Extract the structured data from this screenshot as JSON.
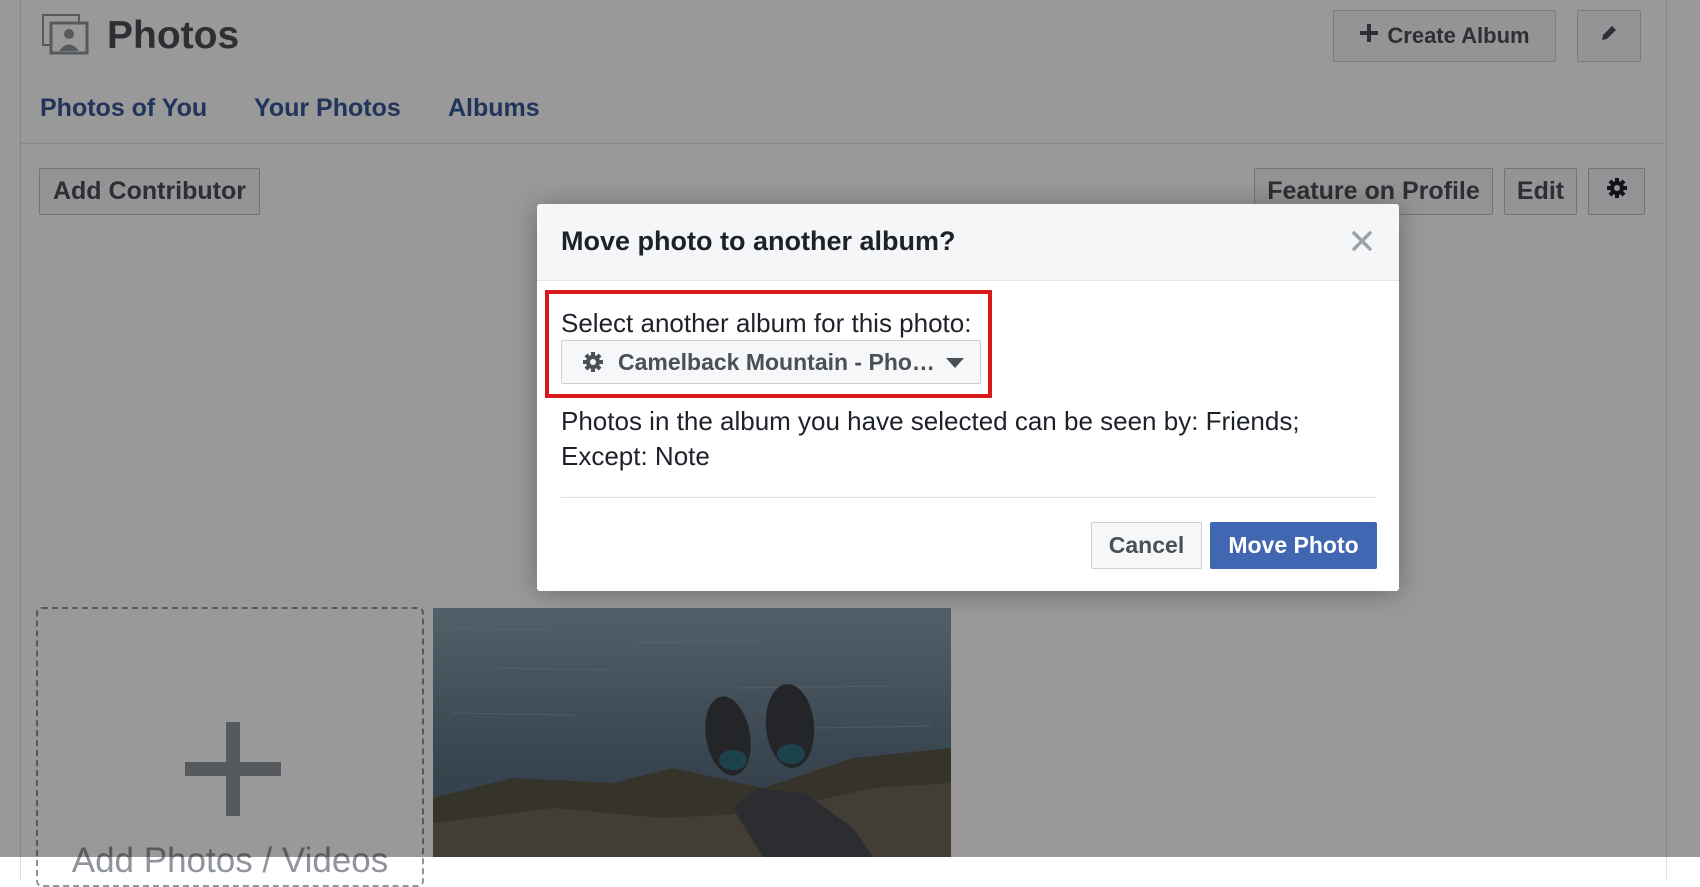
{
  "header": {
    "title": "Photos",
    "photos_icon": "photos-icon",
    "create_album_label": "Create Album",
    "create_album_icon": "plus-icon",
    "edit_icon": "pencil-icon"
  },
  "tabs": [
    {
      "label": "Photos of You"
    },
    {
      "label": "Your Photos"
    },
    {
      "label": "Albums"
    }
  ],
  "album_toolbar": {
    "add_contributor_label": "Add Contributor",
    "feature_on_profile_label": "Feature on Profile",
    "edit_label": "Edit",
    "settings_icon": "gear-icon"
  },
  "grid": {
    "add_tile_label": "Add Photos / Videos",
    "add_tile_icon": "plus-icon"
  },
  "dialog": {
    "title": "Move photo to another album?",
    "close_icon": "close-icon",
    "select_label": "Select another album for this photo:",
    "selected_album": "Camelback Mountain - Pho…",
    "album_icon": "gear-icon",
    "privacy_note": "Photos in the album you have selected can be seen by: Friends; Except: Note",
    "cancel_label": "Cancel",
    "confirm_label": "Move Photo"
  },
  "colors": {
    "link_blue": "#365899",
    "primary_button": "#4267b2",
    "highlight_red": "#d91a1a",
    "overlay": "rgba(0,0,0,0.4)"
  }
}
